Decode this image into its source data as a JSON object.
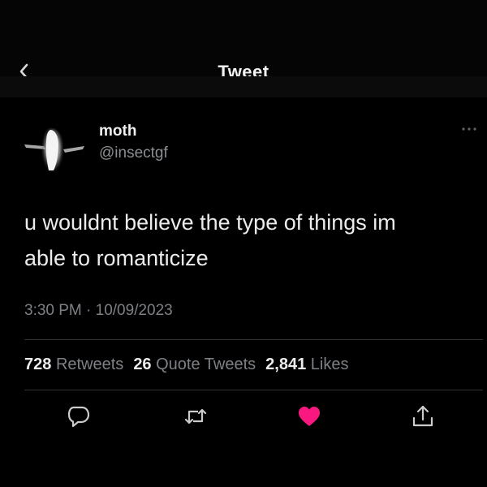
{
  "header": {
    "title": "Tweet"
  },
  "tweet": {
    "author_name": "moth",
    "author_handle": "@insectgf",
    "text_line1": "u wouldnt believe the type of things im",
    "text_line2": "able to romanticize",
    "timestamp": "3:30 PM · 10/09/2023",
    "stats": {
      "retweets_count": "728",
      "retweets_label": "Retweets",
      "quotes_count": "26",
      "quotes_label": "Quote Tweets",
      "likes_count": "2,841",
      "likes_label": "Likes"
    },
    "liked": true
  },
  "icons": {
    "back": "chevron-left-icon",
    "more": "more-dots-icon",
    "reply": "reply-bubble-icon",
    "retweet": "retweet-icon",
    "like": "heart-icon",
    "share": "share-icon"
  },
  "colors": {
    "background": "#000000",
    "text": "#ececec",
    "secondary": "#7d8186",
    "like": "#f91880",
    "divider": "#2f3336"
  }
}
